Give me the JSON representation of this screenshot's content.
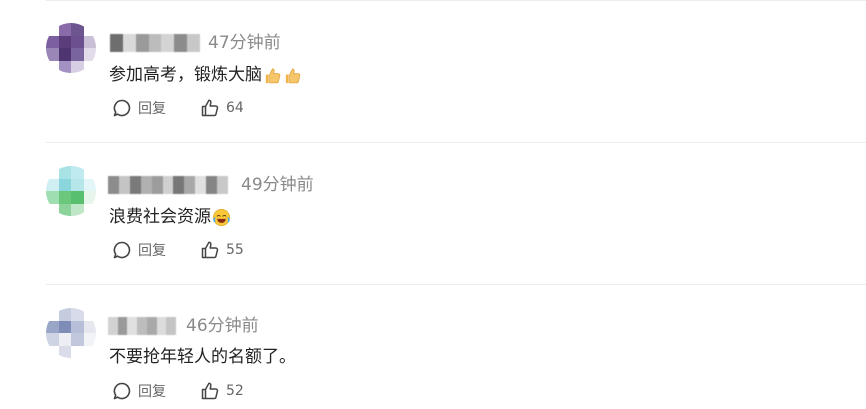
{
  "comments": [
    {
      "time": "47分钟前",
      "text": "参加高考，锻炼大脑",
      "emojis": [
        "thumbs-up-emoji",
        "thumbs-up-emoji"
      ],
      "reply_label": "回复",
      "likes": "64",
      "avatar_colors": [
        "#ffffff",
        "#8a6aa8",
        "#6d5590",
        "#ffffff",
        "#7c5fa0",
        "#5a3d7a",
        "#6b4f8f",
        "#c9bfd6",
        "#9b86b8",
        "#4e3470",
        "#7a64a0",
        "#e2dbe9",
        "#ffffff",
        "#a291c2",
        "#d7cfe3",
        "#ffffff"
      ],
      "name_colors": [
        "#6e6e6e",
        "#dadada",
        "#9a9a9a",
        "#bcbcbc",
        "#d4d4d4",
        "#8c8c8c",
        "#c8c8c8"
      ]
    },
    {
      "time": "49分钟前",
      "text": "浪费社会资源",
      "emojis": [
        "laughing-crying-emoji"
      ],
      "reply_label": "回复",
      "likes": "55",
      "avatar_colors": [
        "#ffffff",
        "#a8e2e6",
        "#bfeaf0",
        "#ffffff",
        "#cfeff2",
        "#8ad6dc",
        "#b6e6ea",
        "#e3f6f7",
        "#9fdeb0",
        "#6bc77c",
        "#58bf6e",
        "#e8f5ea",
        "#ffffff",
        "#8cd39b",
        "#bfe6c6",
        "#ffffff"
      ],
      "name_colors": [
        "#8c8c8c",
        "#c4c4c4",
        "#7a7a7a",
        "#b0b0b0",
        "#9c9c9c",
        "#d0d0d0",
        "#777777",
        "#a8a8a8",
        "#e0e0e0",
        "#858585",
        "#c8c8c8"
      ]
    },
    {
      "time": "46分钟前",
      "text": "不要抢年轻人的名额了。",
      "emojis": [],
      "reply_label": "回复",
      "likes": "52",
      "avatar_colors": [
        "#ffffff",
        "#c6cce0",
        "#d8dcea",
        "#ffffff",
        "#9aa6c8",
        "#7f8cb8",
        "#b6bed8",
        "#e6e8f0",
        "#cfd4e4",
        "#eceef4",
        "#c1c7dc",
        "#f2f3f7",
        "#ffffff",
        "#dadde9",
        "#ffffff",
        "#ffffff"
      ],
      "name_colors": [
        "#d2d2d2",
        "#9a9a9a",
        "#e0e0e0",
        "#bdbdbd",
        "#a9a9a9",
        "#dcdcdc",
        "#c4c4c4"
      ]
    }
  ]
}
